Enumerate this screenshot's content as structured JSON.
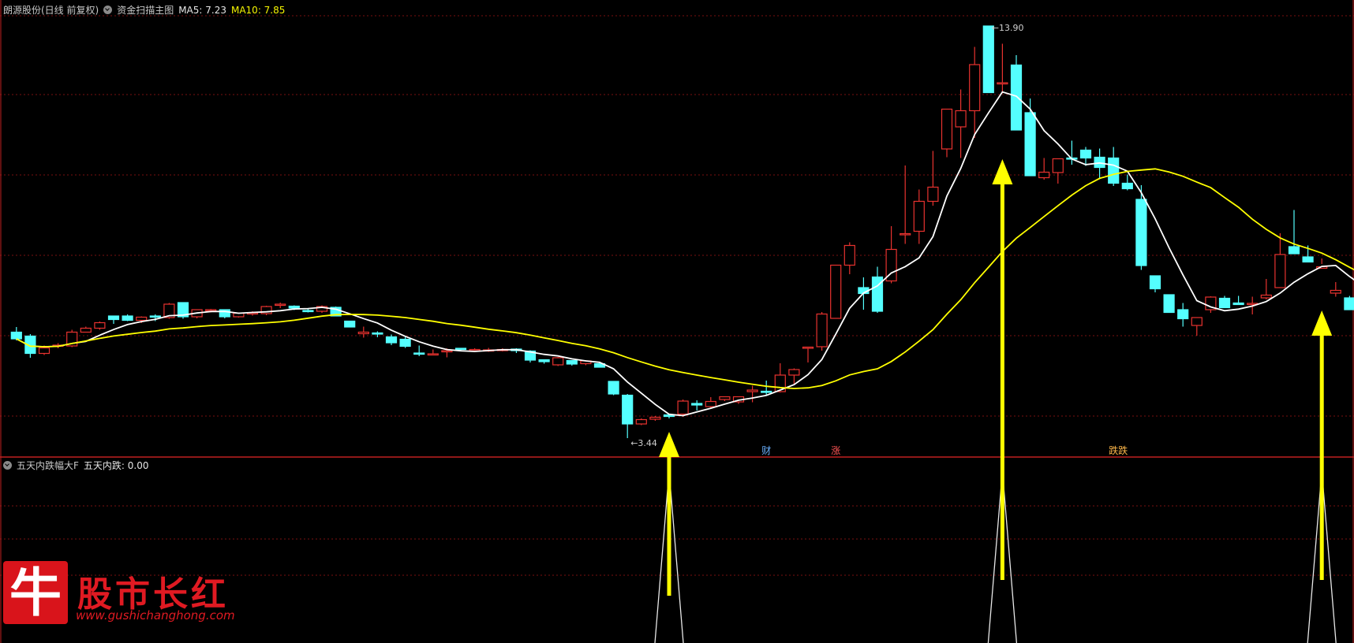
{
  "header_main": {
    "stock": "朗源股份(日线 前复权)",
    "indicator": "资金扫描主图",
    "ma5_label": "MA5: 7.23",
    "ma10_label": "MA10: 7.85"
  },
  "header_sub": {
    "indicator": "五天内跌幅大F",
    "value_label": "五天内跌: 0.00"
  },
  "markers": {
    "high_label": "13.90",
    "low_label": "3.44",
    "cai": "财",
    "zhang": "涨",
    "diedie": "跌跌"
  },
  "logo": {
    "glyph": "牛",
    "title": "股市长红",
    "url": "www.gushichanghong.com"
  },
  "colors": {
    "up": "#e8322f",
    "down": "#54ffff",
    "ma5": "#ffffff",
    "ma10": "#ffff00",
    "grid": "#7a1010",
    "arrow": "#ffff00"
  },
  "chart_data": {
    "type": "candlestick",
    "price_range": [
      3.0,
      14.2
    ],
    "candles": [
      [
        6.13,
        6.26,
        5.92,
        5.96
      ],
      [
        6.03,
        6.08,
        5.48,
        5.59
      ],
      [
        5.59,
        5.79,
        5.55,
        5.73
      ],
      [
        5.79,
        5.85,
        5.72,
        5.8
      ],
      [
        5.78,
        6.19,
        5.75,
        6.13
      ],
      [
        6.13,
        6.27,
        6.12,
        6.23
      ],
      [
        6.23,
        6.4,
        6.19,
        6.37
      ],
      [
        6.54,
        6.48,
        6.34,
        6.45
      ],
      [
        6.54,
        6.58,
        6.41,
        6.43
      ],
      [
        6.43,
        6.53,
        6.36,
        6.51
      ],
      [
        6.54,
        6.58,
        6.41,
        6.51
      ],
      [
        6.5,
        6.87,
        6.47,
        6.84
      ],
      [
        6.88,
        6.88,
        6.47,
        6.52
      ],
      [
        6.52,
        6.7,
        6.48,
        6.7
      ],
      [
        6.69,
        6.72,
        6.63,
        6.7
      ],
      [
        6.7,
        6.71,
        6.48,
        6.52
      ],
      [
        6.52,
        6.63,
        6.5,
        6.61
      ],
      [
        6.6,
        6.66,
        6.55,
        6.62
      ],
      [
        6.6,
        6.8,
        6.56,
        6.78
      ],
      [
        6.82,
        6.88,
        6.74,
        6.84
      ],
      [
        6.79,
        6.81,
        6.69,
        6.74
      ],
      [
        6.68,
        6.73,
        6.63,
        6.66
      ],
      [
        6.66,
        6.81,
        6.62,
        6.78
      ],
      [
        6.76,
        6.78,
        6.61,
        6.54
      ],
      [
        6.41,
        6.39,
        6.26,
        6.26
      ],
      [
        6.09,
        6.27,
        5.99,
        6.13
      ],
      [
        6.11,
        6.15,
        6.0,
        6.1
      ],
      [
        6.01,
        6.07,
        5.8,
        5.86
      ],
      [
        5.95,
        6.03,
        5.73,
        5.77
      ],
      [
        5.6,
        5.79,
        5.52,
        5.57
      ],
      [
        5.56,
        5.69,
        5.54,
        5.58
      ],
      [
        5.66,
        5.72,
        5.49,
        5.66
      ],
      [
        5.72,
        5.72,
        5.64,
        5.7
      ],
      [
        5.66,
        5.72,
        5.64,
        5.69
      ],
      [
        5.68,
        5.73,
        5.63,
        5.68
      ],
      [
        5.66,
        5.72,
        5.64,
        5.69
      ],
      [
        5.7,
        5.72,
        5.6,
        5.66
      ],
      [
        5.65,
        5.67,
        5.36,
        5.42
      ],
      [
        5.43,
        5.44,
        5.33,
        5.38
      ],
      [
        5.3,
        5.5,
        5.27,
        5.48
      ],
      [
        5.41,
        5.41,
        5.28,
        5.32
      ],
      [
        5.33,
        5.42,
        5.29,
        5.4
      ],
      [
        5.33,
        5.35,
        5.23,
        5.24
      ],
      [
        4.88,
        4.87,
        4.53,
        4.56
      ],
      [
        4.53,
        4.56,
        3.44,
        3.8
      ],
      [
        3.8,
        3.94,
        3.77,
        3.91
      ],
      [
        3.92,
        4.0,
        3.88,
        3.97
      ],
      [
        4.03,
        4.01,
        3.94,
        3.99
      ],
      [
        4.05,
        4.42,
        3.98,
        4.38
      ],
      [
        4.32,
        4.4,
        4.14,
        4.28
      ],
      [
        4.24,
        4.48,
        4.2,
        4.37
      ],
      [
        4.42,
        4.5,
        4.38,
        4.49
      ],
      [
        4.36,
        4.5,
        4.31,
        4.49
      ],
      [
        4.62,
        4.77,
        4.35,
        4.66
      ],
      [
        4.63,
        4.9,
        4.54,
        4.62
      ],
      [
        4.62,
        5.34,
        4.6,
        5.04
      ],
      [
        5.04,
        5.21,
        4.82,
        5.18
      ],
      [
        5.72,
        5.74,
        5.36,
        5.75
      ],
      [
        5.76,
        6.64,
        5.66,
        6.59
      ],
      [
        6.48,
        7.53,
        6.48,
        7.83
      ],
      [
        7.83,
        8.41,
        7.6,
        8.33
      ],
      [
        7.26,
        7.52,
        6.7,
        7.11
      ],
      [
        7.53,
        7.79,
        6.62,
        6.66
      ],
      [
        7.43,
        8.82,
        7.37,
        8.23
      ],
      [
        8.63,
        10.36,
        8.37,
        8.63
      ],
      [
        8.69,
        9.75,
        8.37,
        9.45
      ],
      [
        9.45,
        10.73,
        9.34,
        9.81
      ],
      [
        10.78,
        11.25,
        10.57,
        11.79
      ],
      [
        11.34,
        12.29,
        10.55,
        11.75
      ],
      [
        11.75,
        13.37,
        11.06,
        12.92
      ],
      [
        13.9,
        13.9,
        12.23,
        12.21
      ],
      [
        12.46,
        13.45,
        12.19,
        12.46
      ],
      [
        12.91,
        13.16,
        11.81,
        11.26
      ],
      [
        11.7,
        12.06,
        10.69,
        10.1
      ],
      [
        10.05,
        10.55,
        10.0,
        10.19
      ],
      [
        10.18,
        10.54,
        9.9,
        10.53
      ],
      [
        10.55,
        10.99,
        10.38,
        10.54
      ],
      [
        10.75,
        10.83,
        10.35,
        10.55
      ],
      [
        10.57,
        10.79,
        10.01,
        10.31
      ],
      [
        10.55,
        10.83,
        9.84,
        9.91
      ],
      [
        9.91,
        10.13,
        9.73,
        9.77
      ],
      [
        9.5,
        9.86,
        7.71,
        7.82
      ],
      [
        7.56,
        7.31,
        7.14,
        7.23
      ],
      [
        7.08,
        7.02,
        6.73,
        6.63
      ],
      [
        6.7,
        6.87,
        6.27,
        6.47
      ],
      [
        6.3,
        6.44,
        6.04,
        6.5
      ],
      [
        6.7,
        7.04,
        6.62,
        7.02
      ],
      [
        6.99,
        7.05,
        6.75,
        6.75
      ],
      [
        6.87,
        7.05,
        6.84,
        6.83
      ],
      [
        6.86,
        7.03,
        6.58,
        6.86
      ],
      [
        7.0,
        7.48,
        6.96,
        7.07
      ],
      [
        7.26,
        8.64,
        7.25,
        8.1
      ],
      [
        8.3,
        9.23,
        8.27,
        8.12
      ],
      [
        8.04,
        8.33,
        7.91,
        7.91
      ],
      [
        7.75,
        8.0,
        7.86,
        7.79
      ],
      [
        7.12,
        7.4,
        7.03,
        7.19
      ],
      [
        7.0,
        7.05,
        6.78,
        6.7
      ],
      [
        6.89,
        6.9,
        6.85,
        6.86
      ],
      [
        6.83,
        6.95,
        6.54,
        6.72
      ],
      [
        6.81,
        7.22,
        6.64,
        7.13
      ]
    ],
    "ma_periods": [
      5,
      10
    ],
    "sub_indicator_range": [
      0,
      1
    ],
    "arrow_candle_indices": [
      47,
      71,
      94
    ],
    "label_candle_indices": {
      "cai": 54,
      "zhang": 59,
      "diedie": 79
    }
  }
}
